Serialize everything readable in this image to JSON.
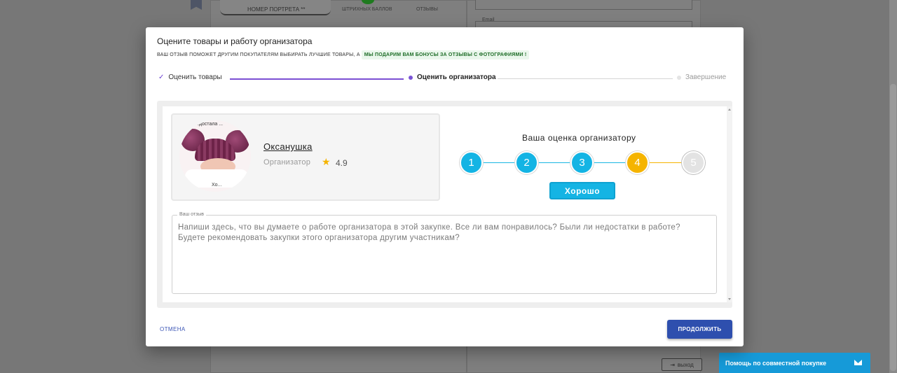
{
  "background": {
    "tab_label": "НОМЕР ПОРТРЕТА **",
    "stat1_label": "ШТРИХНЫХ БАЛЛОВ",
    "stat2_label": "ОТЗЫВЫ",
    "email_label": "Email",
    "exit_label": "выход"
  },
  "help": {
    "label": "Помощь по совместной покупке",
    "icon": "mail-icon"
  },
  "modal": {
    "title": "Оцените товары и работу организатора",
    "subtitle": "ВАШ ОТЗЫВ ПОМОЖЕТ ДРУГИМ ПОКУПАТЕЛЯМ ВЫБИРАТЬ ЛУЧШИЕ ТОВАРЫ, А",
    "bonus_text": "МЫ ПОДАРИМ ВАМ БОНУСЫ ЗА ОТЗЫВЫ С ФОТОГРАФИЯМИ !",
    "steps": [
      {
        "label": "Оценить товары",
        "state": "done"
      },
      {
        "label": "Оценить организатора",
        "state": "active"
      },
      {
        "label": "Завершение",
        "state": "pending"
      }
    ],
    "organizer": {
      "name": "Оксанушка",
      "role": "Организатор",
      "rating": "4.9",
      "avatar_text_top": "...достала ...",
      "avatar_text_bottom": "Хо..."
    },
    "rating_block": {
      "title": "Ваша оценка организатору",
      "options": [
        "1",
        "2",
        "3",
        "4",
        "5"
      ],
      "selected": 4,
      "selected_label": "Хорошо"
    },
    "review": {
      "label": "Ваш отзыв",
      "placeholder": "Напиши здесь, что вы думаете о работе организатора в этой закупке. Все ли вам понравилось? Были ли недостатки в работе? Будете рекомендовать закупки этого организатора другим участникам?"
    },
    "cancel_label": "ОТМЕНА",
    "continue_label": "ПРОДОЛЖИТЬ"
  },
  "colors": {
    "accent_blue": "#14b4e4",
    "accent_yellow": "#f5b400",
    "primary_button": "#2e4fae",
    "stepper_purple": "#7b4fd3"
  }
}
